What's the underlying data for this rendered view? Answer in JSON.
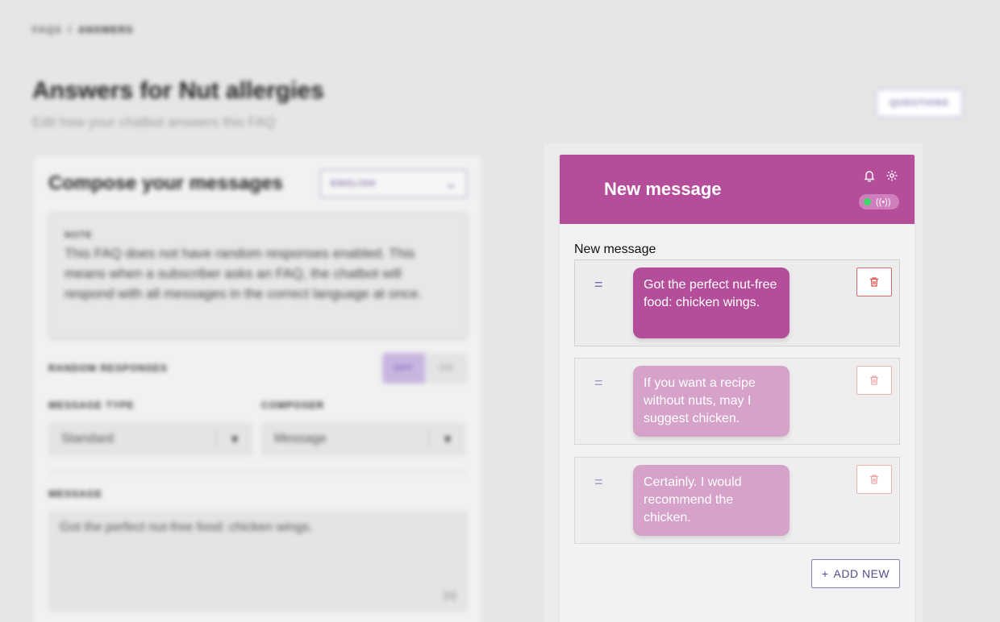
{
  "breadcrumb": {
    "parent": "FAQS",
    "separator": "/",
    "current": "ANSWERS"
  },
  "page": {
    "title": "Answers for Nut allergies",
    "subtitle": "Edit how your chatbot answers this FAQ",
    "questions_button": "QUESTIONS"
  },
  "compose": {
    "title": "Compose your messages",
    "language": "ENGLISH",
    "note_label": "NOTE",
    "note_text": "This FAQ does not have random responses enabled. This means when a subscriber asks an FAQ, the chatbot will respond with all messages in the correct language at once.",
    "random_label": "RANDOM RESPONSES",
    "toggle_off": "OFF",
    "toggle_on": "ON",
    "toggle_selected": "OFF",
    "message_type_label": "MESSAGE TYPE",
    "message_type_value": "Standard",
    "composer_label": "COMPOSER",
    "composer_value": "Message",
    "message_label": "MESSAGE",
    "message_value": "Got the perfect nut-free food: chicken wings.",
    "variable_hint": "{x}"
  },
  "preview": {
    "header_title": "New message",
    "section_label": "New message",
    "status_color": "#3ddc6a",
    "brand_color": "#b54e9a",
    "messages": [
      {
        "text": "Got the perfect nut-free food: chicken wings.",
        "active": true
      },
      {
        "text": "If you want a recipe without nuts, may I suggest chicken.",
        "active": false
      },
      {
        "text": "Certainly. I would recommend the chicken.",
        "active": false
      }
    ],
    "add_new_label": "ADD NEW",
    "add_new_icon": "+"
  }
}
